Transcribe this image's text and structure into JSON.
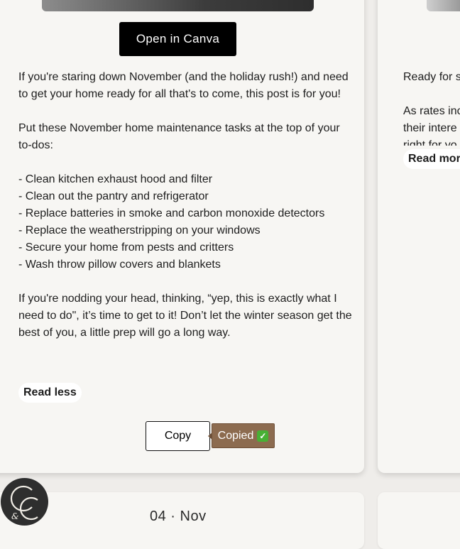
{
  "main_card": {
    "canva_button": "Open in Canva",
    "intro": "If you're staring down November (and the holiday rush!) and need to get your home ready for all that's to come, this post is for you!",
    "lead": "Put these November home maintenance tasks at the top of your to-dos:",
    "tasks": [
      "- Clean kitchen exhaust hood and filter",
      "- Clean out the pantry and refrigerator",
      "- Replace batteries in smoke and carbon monoxide detectors",
      "- Replace the weatherstripping on your windows",
      "- Secure your home from pests and critters",
      "- Wash throw pillow covers and blankets"
    ],
    "closing": "If you're nodding your head, thinking, “yep, this is exactly what I need to do\", it’s time to get to it! Don’t let the winter season get the best of you, a little prep will go a long way.",
    "read_less": "Read less",
    "copy_button": "Copy",
    "copied_tooltip": "Copied",
    "copied_icon": "check-mark-icon"
  },
  "side_card": {
    "text1": "Ready for s",
    "text2_lines": [
      "As rates inc",
      "their intere",
      "right for yo"
    ],
    "read_more": "Read more"
  },
  "next_card": {
    "date": "04 · Nov"
  },
  "logo": {
    "monogram": "CC",
    "icon": "monogram-logo"
  },
  "colors": {
    "background": "#efedea",
    "card": "#f7f6f3",
    "canva_button": "#000000",
    "copied_tooltip": "#8c6b4f",
    "check": "#48b035",
    "logo": "#2e2e2e"
  }
}
